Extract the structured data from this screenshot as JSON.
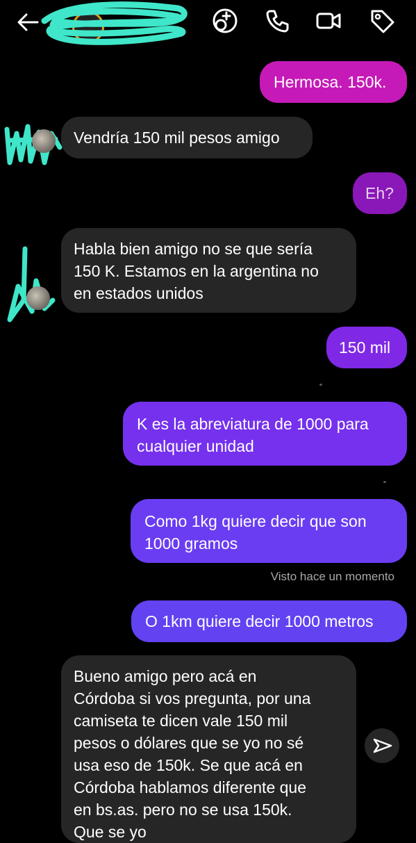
{
  "header": {
    "contact_name": "",
    "subtitle": ""
  },
  "messages": [
    {
      "id": "m1",
      "side": "out",
      "text": "Hermosa. 150k."
    },
    {
      "id": "m2",
      "side": "in",
      "text": "Vendría 150 mil pesos amigo"
    },
    {
      "id": "m3",
      "side": "out",
      "text": "Eh?"
    },
    {
      "id": "m4",
      "side": "in",
      "lines": [
        "Habla bien amigo no se que sería",
        "150 K. Estamos en la argentina no",
        "en estados unidos"
      ]
    },
    {
      "id": "m5",
      "side": "out",
      "text": "150 mil"
    },
    {
      "id": "m6",
      "side": "out",
      "lines": [
        "K es la abreviatura de 1000 para",
        "cualquier unidad"
      ]
    },
    {
      "id": "m7",
      "side": "out",
      "lines": [
        "Como 1kg quiere decir que son",
        "1000 gramos"
      ]
    },
    {
      "id": "m8",
      "side": "out",
      "text": "O 1km quiere decir 1000 metros"
    },
    {
      "id": "m9",
      "side": "in",
      "lines": [
        "Bueno amigo pero acá en",
        "Córdoba si vos pregunta, por una",
        "camiseta te dicen vale 150 mil",
        "pesos o dólares que se yo no sé",
        "usa eso de 150k. Se que acá en",
        "Córdoba hablamos diferente que",
        "en bs.as. pero no se usa 150k.",
        "Que se yo"
      ]
    }
  ],
  "status": {
    "seen": "Visto hace un momento"
  },
  "icons": {
    "back": "arrow-left-icon",
    "add_people": "add-people-icon",
    "call": "phone-icon",
    "video": "video-icon",
    "tag": "tag-icon",
    "share": "send-icon"
  },
  "colors": {
    "bubble_in": "#262626",
    "bubble_out_top": "#d01bb7",
    "bubble_out_bottom": "#6a3df2",
    "scribble": "#3fe6c9"
  }
}
